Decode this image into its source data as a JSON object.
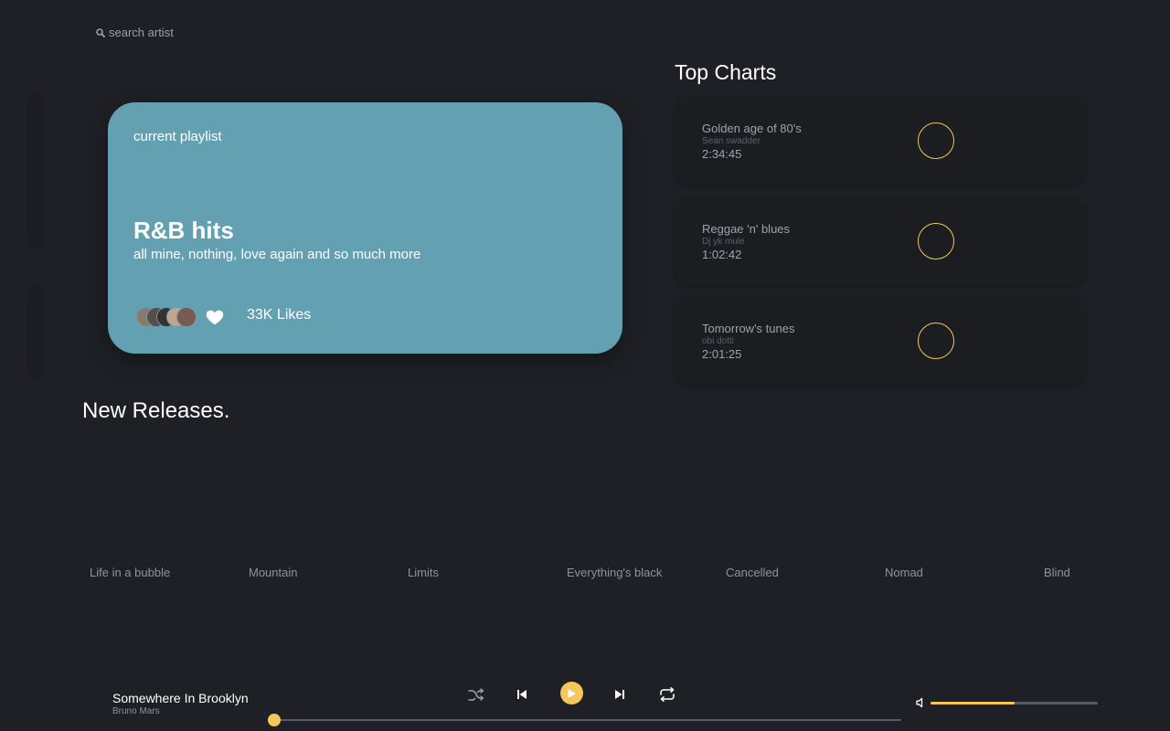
{
  "search": {
    "placeholder": "search artist"
  },
  "hero": {
    "label": "current playlist",
    "title": "R&B hits",
    "subtitle": "all mine, nothing, love again and so much more",
    "likes": "33K Likes",
    "background_color": "#63a0b1"
  },
  "top_charts": {
    "title": "Top Charts",
    "items": [
      {
        "name": "Golden age of 80's",
        "artist": "Sean swadder",
        "duration": "2:34:45"
      },
      {
        "name": "Reggae 'n' blues",
        "artist": "Dj yk mule",
        "duration": "1:02:42"
      },
      {
        "name": "Tomorrow's tunes",
        "artist": "obi dotti",
        "duration": "2:01:25"
      }
    ]
  },
  "new_releases": {
    "title": "New Releases.",
    "items": [
      "Life in a bubble",
      "Mountain",
      "Limits",
      "Everything's black",
      "Cancelled",
      "Nomad",
      "Blind"
    ]
  },
  "player": {
    "track_title": "Somewhere In Brooklyn",
    "track_artist": "Bruno Mars",
    "progress_fraction": 0.0,
    "volume_fraction": 0.5,
    "accent_color": "#f5c75a"
  },
  "icons": {
    "search": "search-icon",
    "heart": "heart-icon",
    "shuffle": "shuffle-icon",
    "previous": "skip-previous-icon",
    "play": "play-icon",
    "next": "skip-next-icon",
    "repeat": "repeat-icon",
    "volume": "volume-icon"
  }
}
